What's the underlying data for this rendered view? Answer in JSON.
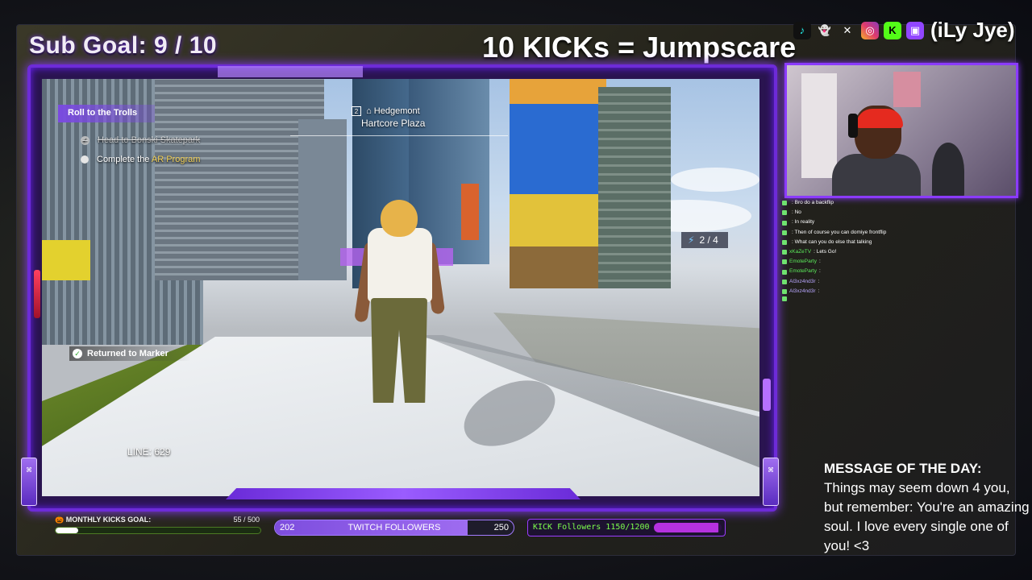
{
  "header": {
    "sub_goal": "Sub Goal:  9 / 10",
    "kicks_jumpscare": "10 KICKs = Jumpscare"
  },
  "social": {
    "icons": [
      "tiktok-icon",
      "snapchat-icon",
      "x-icon",
      "instagram-icon",
      "kick-icon",
      "twitch-icon"
    ],
    "handle": "(iLy Jye)"
  },
  "game": {
    "quest_title": "Roll to the Trolls",
    "quest_items": [
      {
        "text_pre": "Head to Bonski Skatepark",
        "highlight": "",
        "done": true
      },
      {
        "text_pre": "Complete the ",
        "highlight": "AR Program",
        "done": false
      }
    ],
    "location_badge": "2",
    "location_name": "Hedgemont",
    "location_sub": "Hartcore Plaza",
    "counter": "2 / 4",
    "returned": "Returned to Marker",
    "line_counter": "LINE: 629"
  },
  "chat": [
    {
      "user": "",
      "msg": ": Bro do a backflip"
    },
    {
      "user": "",
      "msg": ": No"
    },
    {
      "user": "",
      "msg": ": In reality"
    },
    {
      "user": "",
      "msg": ": Then of course you can domiye frontflip"
    },
    {
      "user": "",
      "msg": ": What can you do else that talking"
    },
    {
      "user": "xKaZeTV",
      "msg": " : Lets Go!"
    },
    {
      "user": "EmoteParty",
      "msg": " :"
    },
    {
      "user": "EmoteParty",
      "msg": " :"
    },
    {
      "user": "Al3xz4nd3r",
      "msg": " :"
    },
    {
      "user": "Al3xz4nd3r",
      "msg": " :"
    },
    {
      "user": "",
      "msg": ""
    }
  ],
  "motd": {
    "heading": "MESSAGE OF THE DAY:",
    "body": "Things may seem down 4 you, but remember: You're an amazing soul. I love every single one of you! <3"
  },
  "goals": {
    "monthly_label": "MONTHLY KICKS GOAL:",
    "monthly_count": "55 / 500",
    "monthly_progress": 0.11,
    "twitch_current": "202",
    "twitch_label": "TWITCH FOLLOWERS",
    "twitch_target": "250",
    "twitch_progress": 0.808,
    "kick_label": "KICK Followers 1150/1200",
    "kick_progress": 0.958
  },
  "colors": {
    "accent_purple": "#8b3bff",
    "kick_green": "#7dff4d",
    "quest_highlight": "#f2d25a"
  }
}
